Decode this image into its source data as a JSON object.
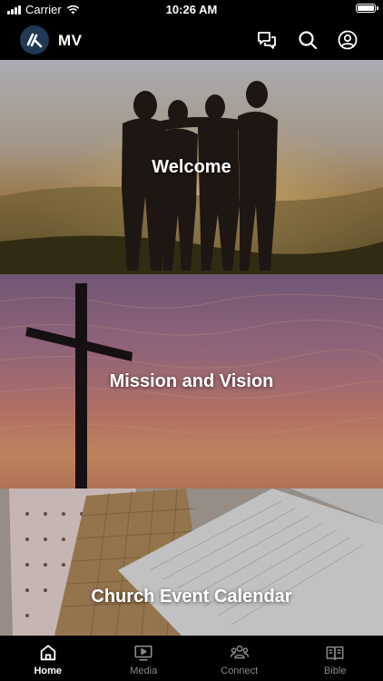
{
  "status_bar": {
    "carrier": "Carrier",
    "time": "10:26 AM"
  },
  "header": {
    "title": "MV",
    "icons": [
      "chat-icon",
      "search-icon",
      "account-icon"
    ]
  },
  "tiles": [
    {
      "label": "Welcome"
    },
    {
      "label": "Mission and Vision"
    },
    {
      "label": "Church Event Calendar"
    }
  ],
  "tabs": [
    {
      "label": "Home",
      "icon": "home-icon",
      "active": true
    },
    {
      "label": "Media",
      "icon": "media-icon",
      "active": false
    },
    {
      "label": "Connect",
      "icon": "connect-icon",
      "active": false
    },
    {
      "label": "Bible",
      "icon": "bible-icon",
      "active": false
    }
  ],
  "colors": {
    "background": "#000000",
    "logo_bg": "#1f3a52",
    "tab_inactive": "#8a8a8e",
    "tab_active": "#ffffff"
  }
}
